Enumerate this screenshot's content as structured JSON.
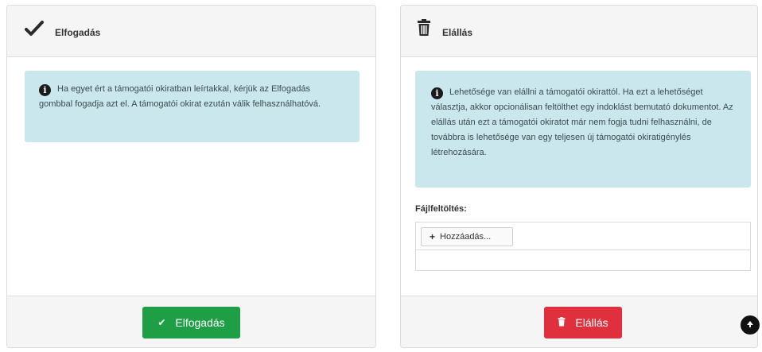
{
  "accept_panel": {
    "title": "Elfogadás",
    "info_text": "Ha egyet ért a támogatói okiratban leírtakkal, kérjük az Elfogadás gombbal fogadja azt el. A támogatói okirat ezután válik felhasználhatóvá.",
    "button_label": "Elfogadás",
    "icon": "check-icon"
  },
  "withdraw_panel": {
    "title": "Elállás",
    "info_text": "Lehetősége van elállni a támogatói okirattól. Ha ezt a lehetőséget választja, akkor opcionálisan feltölthet egy indoklást bemutató dokumentot. Az elállás után ezt a támogatói okiratot már nem fogja tudni felhasználni, de továbbra is lehetősége van egy teljesen új támogatói okiratigénylés létrehozására.",
    "upload_label": "Fájlfeltöltés:",
    "add_button_label": "Hozzáadás...",
    "button_label": "Elállás",
    "icon": "trash-icon"
  },
  "colors": {
    "accept": "#1e9e45",
    "withdraw": "#e0303e",
    "info_bg": "#c9e7ec"
  }
}
